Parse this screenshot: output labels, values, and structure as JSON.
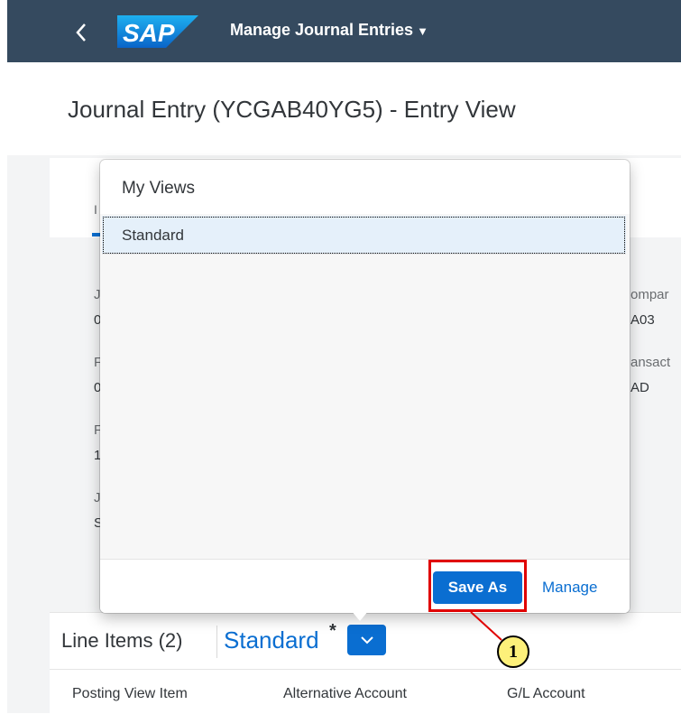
{
  "shell": {
    "logo_text": "SAP",
    "app_title": "Manage Journal Entries",
    "back_icon": "chevron-left-icon",
    "menu_icon": "caret-down-icon"
  },
  "page": {
    "title": "Journal Entry (YCGAB40YG5) - Entry View"
  },
  "background_fields": {
    "left_fragments": [
      "J",
      "0",
      "F",
      "0",
      "F",
      "1",
      "J",
      "S"
    ],
    "right_fragments": [
      "ompar",
      "A03",
      "ansact",
      "AD"
    ]
  },
  "popover": {
    "title": "My Views",
    "items": [
      {
        "label": "Standard",
        "selected": true
      }
    ],
    "save_as_label": "Save As",
    "manage_label": "Manage"
  },
  "line_items": {
    "title": "Line Items (2)",
    "variant": "Standard",
    "modified_marker": "*",
    "variant_toggle_icon": "chevron-down-icon",
    "columns": [
      "Posting View Item",
      "Alternative Account",
      "G/L Account"
    ]
  },
  "annotation": {
    "number": "1",
    "color": "#e00000"
  },
  "colors": {
    "shell": "#354a5f",
    "accent": "#0a6ed1",
    "text": "#32363a"
  }
}
